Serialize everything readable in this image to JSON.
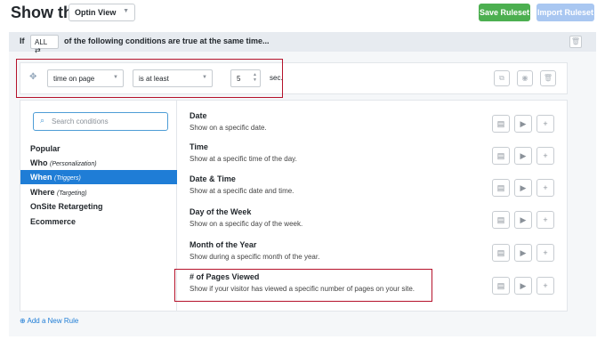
{
  "header": {
    "title": "Show the",
    "view_select": "Optin View",
    "save_label": "Save Ruleset",
    "import_label": "Import Ruleset"
  },
  "conditions_bar": {
    "if_label": "If",
    "all_select": "ALL",
    "text": "of the following conditions are true at the same time..."
  },
  "rule": {
    "field": "time on page",
    "operator": "is at least",
    "value": "5",
    "unit": "sec."
  },
  "picker": {
    "search_placeholder": "Search conditions",
    "categories": [
      {
        "label": "Popular",
        "sub": ""
      },
      {
        "label": "Who",
        "sub": "(Personalization)"
      },
      {
        "label": "When",
        "sub": "(Triggers)"
      },
      {
        "label": "Where",
        "sub": "(Targeting)"
      },
      {
        "label": "OnSite Retargeting",
        "sub": ""
      },
      {
        "label": "Ecommerce",
        "sub": ""
      }
    ],
    "options": [
      {
        "title": "Date",
        "desc": "Show on a specific date."
      },
      {
        "title": "Time",
        "desc": "Show at a specific time of the day."
      },
      {
        "title": "Date & Time",
        "desc": "Show at a specific date and time."
      },
      {
        "title": "Day of the Week",
        "desc": "Show on a specific day of the week."
      },
      {
        "title": "Month of the Year",
        "desc": "Show during a specific month of the year."
      },
      {
        "title": "# of Pages Viewed",
        "desc": "Show if your visitor has viewed a specific number of pages on your site."
      }
    ]
  },
  "add_rule": "Add a New Rule",
  "colors": {
    "accent": "#1f7dd6",
    "save": "#4caf50",
    "highlight": "#b5122b"
  }
}
